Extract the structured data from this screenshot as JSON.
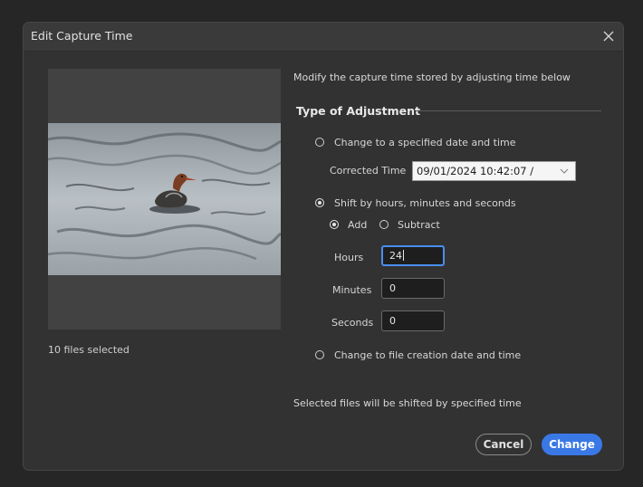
{
  "dialog": {
    "title": "Edit Capture Time",
    "close_icon": "close-icon"
  },
  "preview": {
    "files_selected": "10 files selected",
    "image": "merganser-duck-on-water"
  },
  "form": {
    "description": "Modify the capture time stored by adjusting time below",
    "section_title": "Type of Adjustment",
    "options": {
      "specified_label": "Change to a specified date and time",
      "shift_label": "Shift by hours, minutes and seconds",
      "file_creation_label": "Change to file creation date and time",
      "selected": "shift"
    },
    "corrected_time": {
      "label": "Corrected Time",
      "value": "09/01/2024  10:42:07 /"
    },
    "direction": {
      "add_label": "Add",
      "subtract_label": "Subtract",
      "selected": "add"
    },
    "hours": {
      "label": "Hours",
      "value": "24"
    },
    "minutes": {
      "label": "Minutes",
      "value": "0"
    },
    "seconds": {
      "label": "Seconds",
      "value": "0"
    },
    "summary": "Selected files will be shifted by specified time"
  },
  "buttons": {
    "cancel_label": "Cancel",
    "change_label": "Change"
  },
  "colors": {
    "accent": "#3a78e6",
    "dialog_bg": "#323232",
    "focus": "#4a8ef0"
  }
}
